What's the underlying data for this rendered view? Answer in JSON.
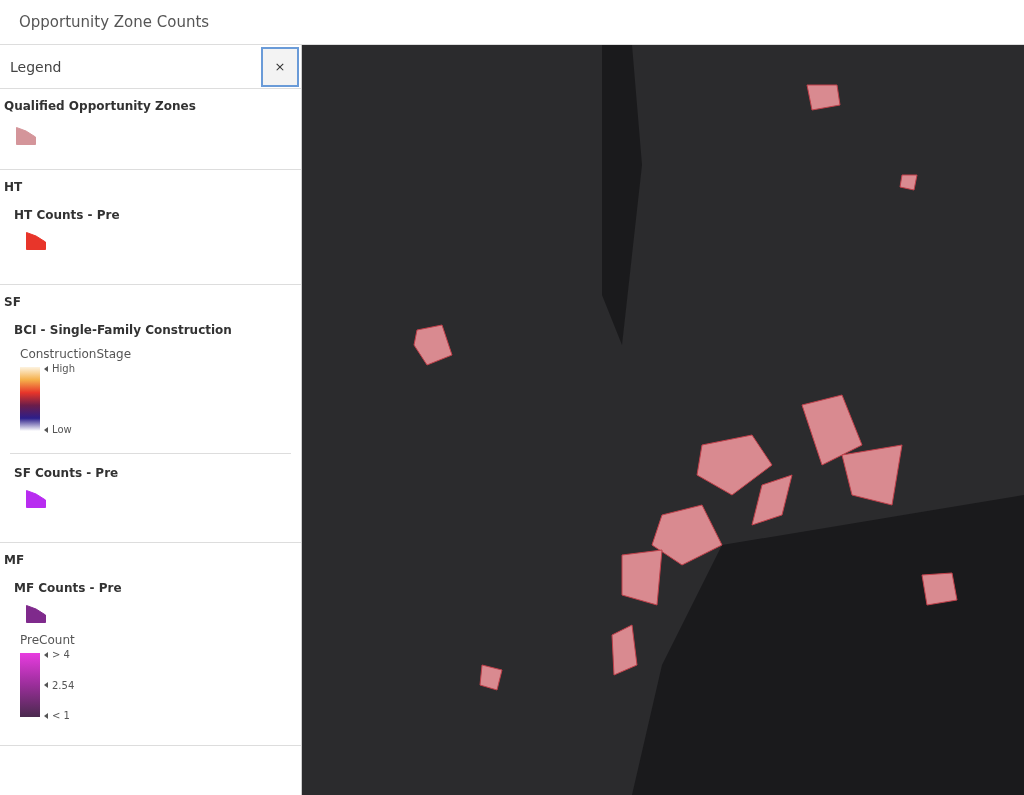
{
  "header": {
    "title": "Opportunity Zone Counts"
  },
  "legend": {
    "title": "Legend",
    "close": "×",
    "groups": [
      {
        "kind": "layer",
        "title": "Qualified Opportunity Zones",
        "layers": [
          {
            "kind": "swatch",
            "color": "#d4959a"
          }
        ]
      },
      {
        "kind": "group",
        "title": "HT",
        "layers": [
          {
            "kind": "layer",
            "title": "HT Counts - Pre",
            "items": [
              {
                "kind": "swatch",
                "color": "#e8352a"
              }
            ]
          }
        ]
      },
      {
        "kind": "group",
        "title": "SF",
        "layers": [
          {
            "kind": "layer",
            "title": "BCI - Single-Family Construction",
            "items": [
              {
                "kind": "heatramp",
                "field": "ConstructionStage",
                "labels": [
                  "High",
                  "Low"
                ]
              }
            ]
          },
          {
            "kind": "layer",
            "title": "SF Counts - Pre",
            "items": [
              {
                "kind": "swatch",
                "color": "#b82cf0"
              }
            ]
          }
        ]
      },
      {
        "kind": "group",
        "title": "MF",
        "layers": [
          {
            "kind": "layer",
            "title": "MF Counts - Pre",
            "items": [
              {
                "kind": "swatch",
                "color": "#7f2a8c"
              },
              {
                "kind": "purpleramp",
                "field": "PreCount",
                "labels": [
                  "> 4",
                  "2.54",
                  "< 1"
                ]
              }
            ]
          }
        ]
      }
    ]
  }
}
